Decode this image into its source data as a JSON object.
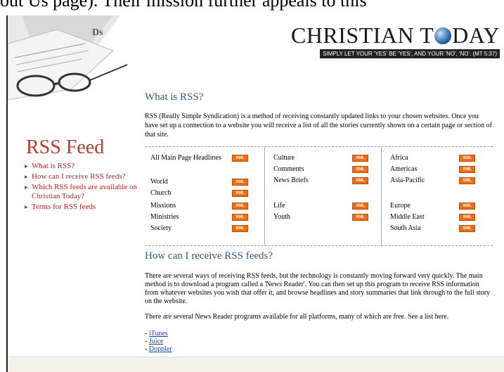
{
  "top_text": "out Us page).  Their mission further appeals to this",
  "brand": {
    "name_left": "CHRISTIAN T",
    "name_right": "DAY",
    "tagline": "SIMPLY LET YOUR 'YES' BE 'YES', AND YOUR 'NO', 'NO'. (MT 5:37)"
  },
  "sidebar": {
    "title": "RSS Feed",
    "items": [
      {
        "label": "What is RSS?"
      },
      {
        "label": "How can I receive RSS feeds?"
      },
      {
        "label": "Which RSS feeds are available on Christian Today?"
      },
      {
        "label": "Terms for RSS feeds"
      }
    ]
  },
  "what": {
    "title": "What is RSS?",
    "text": "RSS (Really Simple Syndication) is a method of receiving constantly updated links to your chosen websites. Once you have set up a connection to a website you will receive a list of all the stories currently shown on a certain page or section of that site."
  },
  "feeds": {
    "xml_label": "XML",
    "col1": [
      "All Main Page Headlines",
      "World",
      "Church",
      "Missions",
      "Ministries",
      "Society"
    ],
    "col2": [
      "Culture",
      "Comments",
      "News Briefs",
      "Life",
      "Youth"
    ],
    "col3": [
      "Africa",
      "Americas",
      "Asia-Pacific",
      "Europe",
      "Middle East",
      "South Asia"
    ]
  },
  "how": {
    "title": "How can I receive RSS feeds?",
    "text1": "There are several ways of receiving RSS feeds, but the technology is constantly moving forward very quickly. The main method is to download a program called a 'News Reader'. You can then set up this program to receive RSS information from whatever websites you wish that offer it, and browse headlines and story summaries that link through to the full story on the website.",
    "text2": "There are several News Reader programs available for all platforms, many of which are free. See a list here.",
    "readers": [
      "iTunes",
      "Juice",
      "Doppler"
    ]
  }
}
